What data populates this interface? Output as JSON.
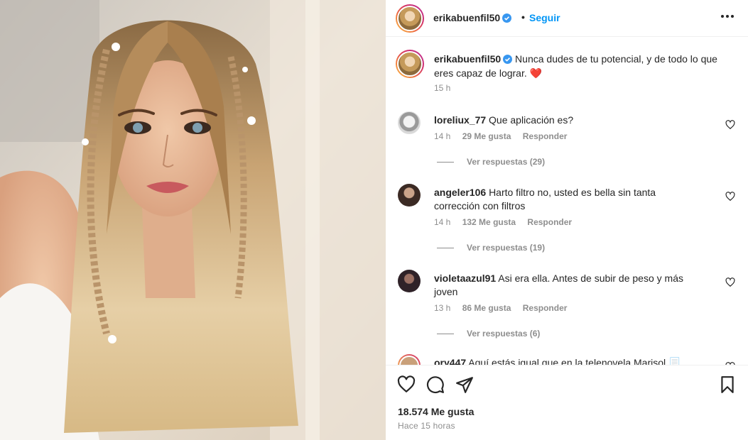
{
  "post": {
    "username": "erikabuenfil50",
    "separator": "•",
    "follow_label": "Seguir",
    "caption": "Nunca dudes de tu potencial, y de todo lo que eres capaz de lograr. ❤️",
    "caption_time": "15 h"
  },
  "comments": [
    {
      "username": "loreliux_77",
      "text": "Que aplicación es?",
      "time": "14 h",
      "likes": "29 Me gusta",
      "reply_label": "Responder",
      "view_replies": "Ver respuestas (29)"
    },
    {
      "username": "angeler106",
      "text": "Harto filtro no, usted es bella sin tanta corrección con filtros",
      "time": "14 h",
      "likes": "132 Me gusta",
      "reply_label": "Responder",
      "view_replies": "Ver respuestas (19)"
    },
    {
      "username": "violetaazul91",
      "text": "Asi era ella. Antes de subir de peso y más joven",
      "time": "13 h",
      "likes": "86 Me gusta",
      "reply_label": "Responder",
      "view_replies": "Ver respuestas (6)"
    },
    {
      "username": "ory447",
      "text": "Aquí estás igual que en la telenovela Marisol 📃"
    }
  ],
  "footer": {
    "likes": "18.574 Me gusta",
    "posted": "Hace 15 horas"
  },
  "icons": {
    "like": "heart-icon",
    "comment": "comment-icon",
    "share": "send-icon",
    "save": "bookmark-icon",
    "more": "more-dots-icon",
    "verified": "verified-badge-icon"
  },
  "colors": {
    "link": "#0095f6",
    "verified": "#3897f0",
    "heart": "#ed4956",
    "muted": "#8e8e8e",
    "text": "#262626"
  }
}
